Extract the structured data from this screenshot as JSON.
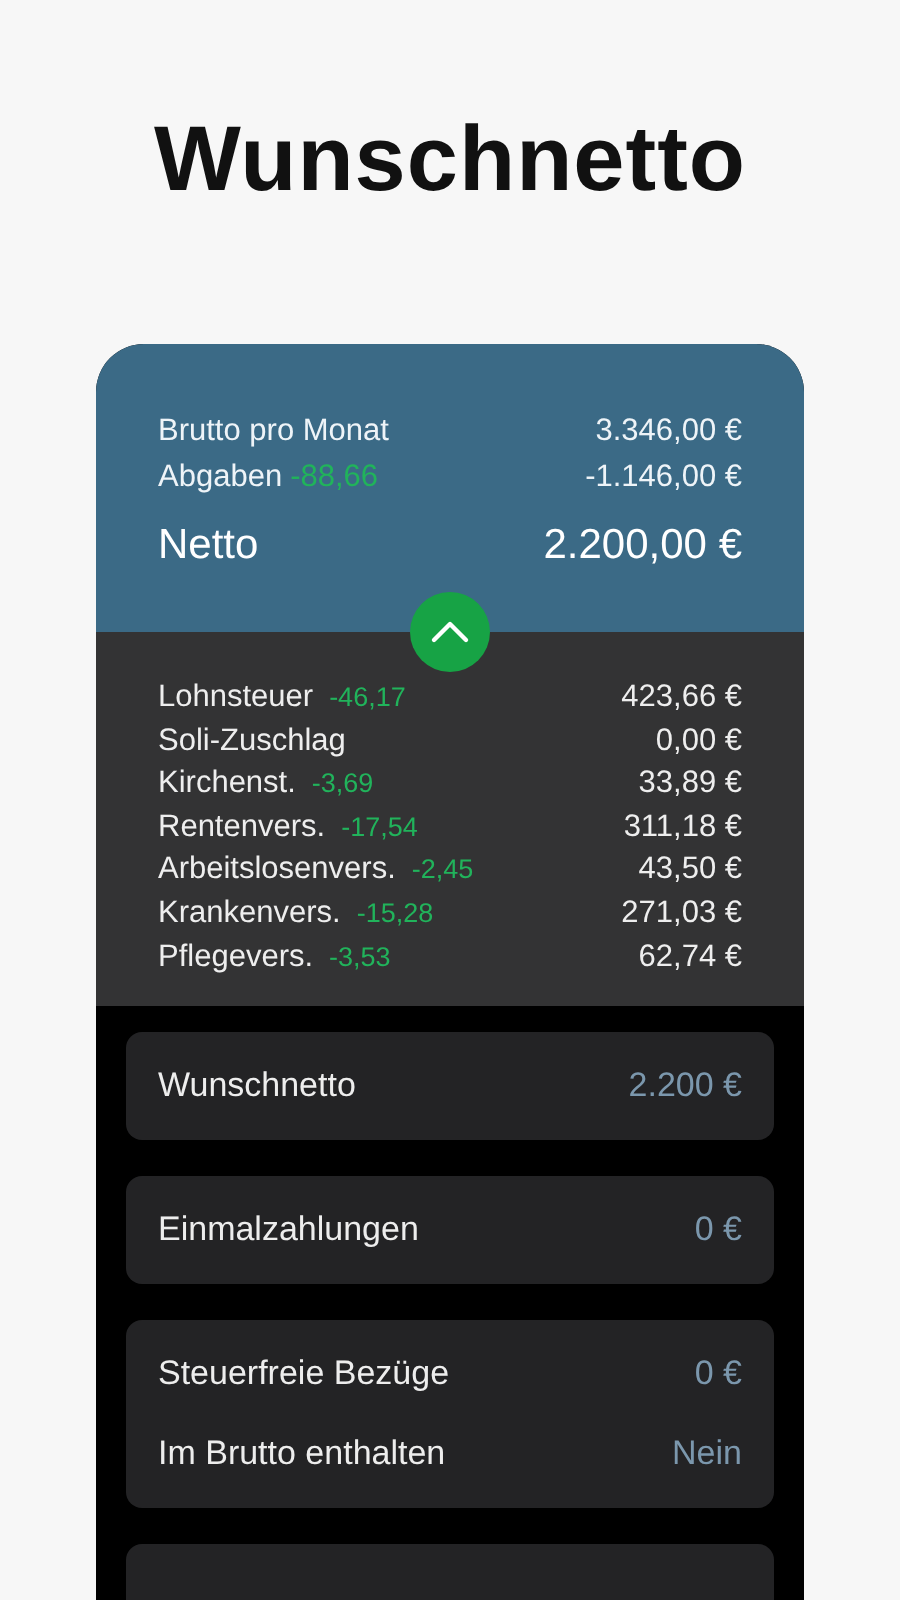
{
  "title": "Wunschnetto",
  "summary": {
    "rows": [
      {
        "label": "Brutto pro Monat",
        "value": "3.346,00 €"
      },
      {
        "label": "Abgaben",
        "delta": "-88,66",
        "value": "-1.146,00 €"
      }
    ],
    "total": {
      "label": "Netto",
      "value": "2.200,00 €"
    }
  },
  "details_toggle": {
    "expanded": true
  },
  "deductions": [
    {
      "label": "Lohnsteuer",
      "delta": "-46,17",
      "value": "423,66 €"
    },
    {
      "label": "Soli-Zuschlag",
      "value": "0,00 €"
    },
    {
      "label": "Kirchenst.",
      "delta": "-3,69",
      "value": "33,89 €"
    },
    {
      "label": "Rentenvers.",
      "delta": "-17,54",
      "value": "311,18 €"
    },
    {
      "label": "Arbeitslosenvers.",
      "delta": "-2,45",
      "value": "43,50 €"
    },
    {
      "label": "Krankenvers.",
      "delta": "-15,28",
      "value": "271,03 €"
    },
    {
      "label": "Pflegevers.",
      "delta": "-3,53",
      "value": "62,74 €"
    }
  ],
  "cards": [
    {
      "rows": [
        {
          "label": "Wunschnetto",
          "value": "2.200 €"
        }
      ]
    },
    {
      "rows": [
        {
          "label": "Einmalzahlungen",
          "value": "0 €"
        }
      ]
    },
    {
      "rows": [
        {
          "label": "Steuerfreie Bezüge",
          "value": "0 €"
        },
        {
          "label": "Im Brutto enthalten",
          "value": "Nein"
        }
      ]
    }
  ]
}
